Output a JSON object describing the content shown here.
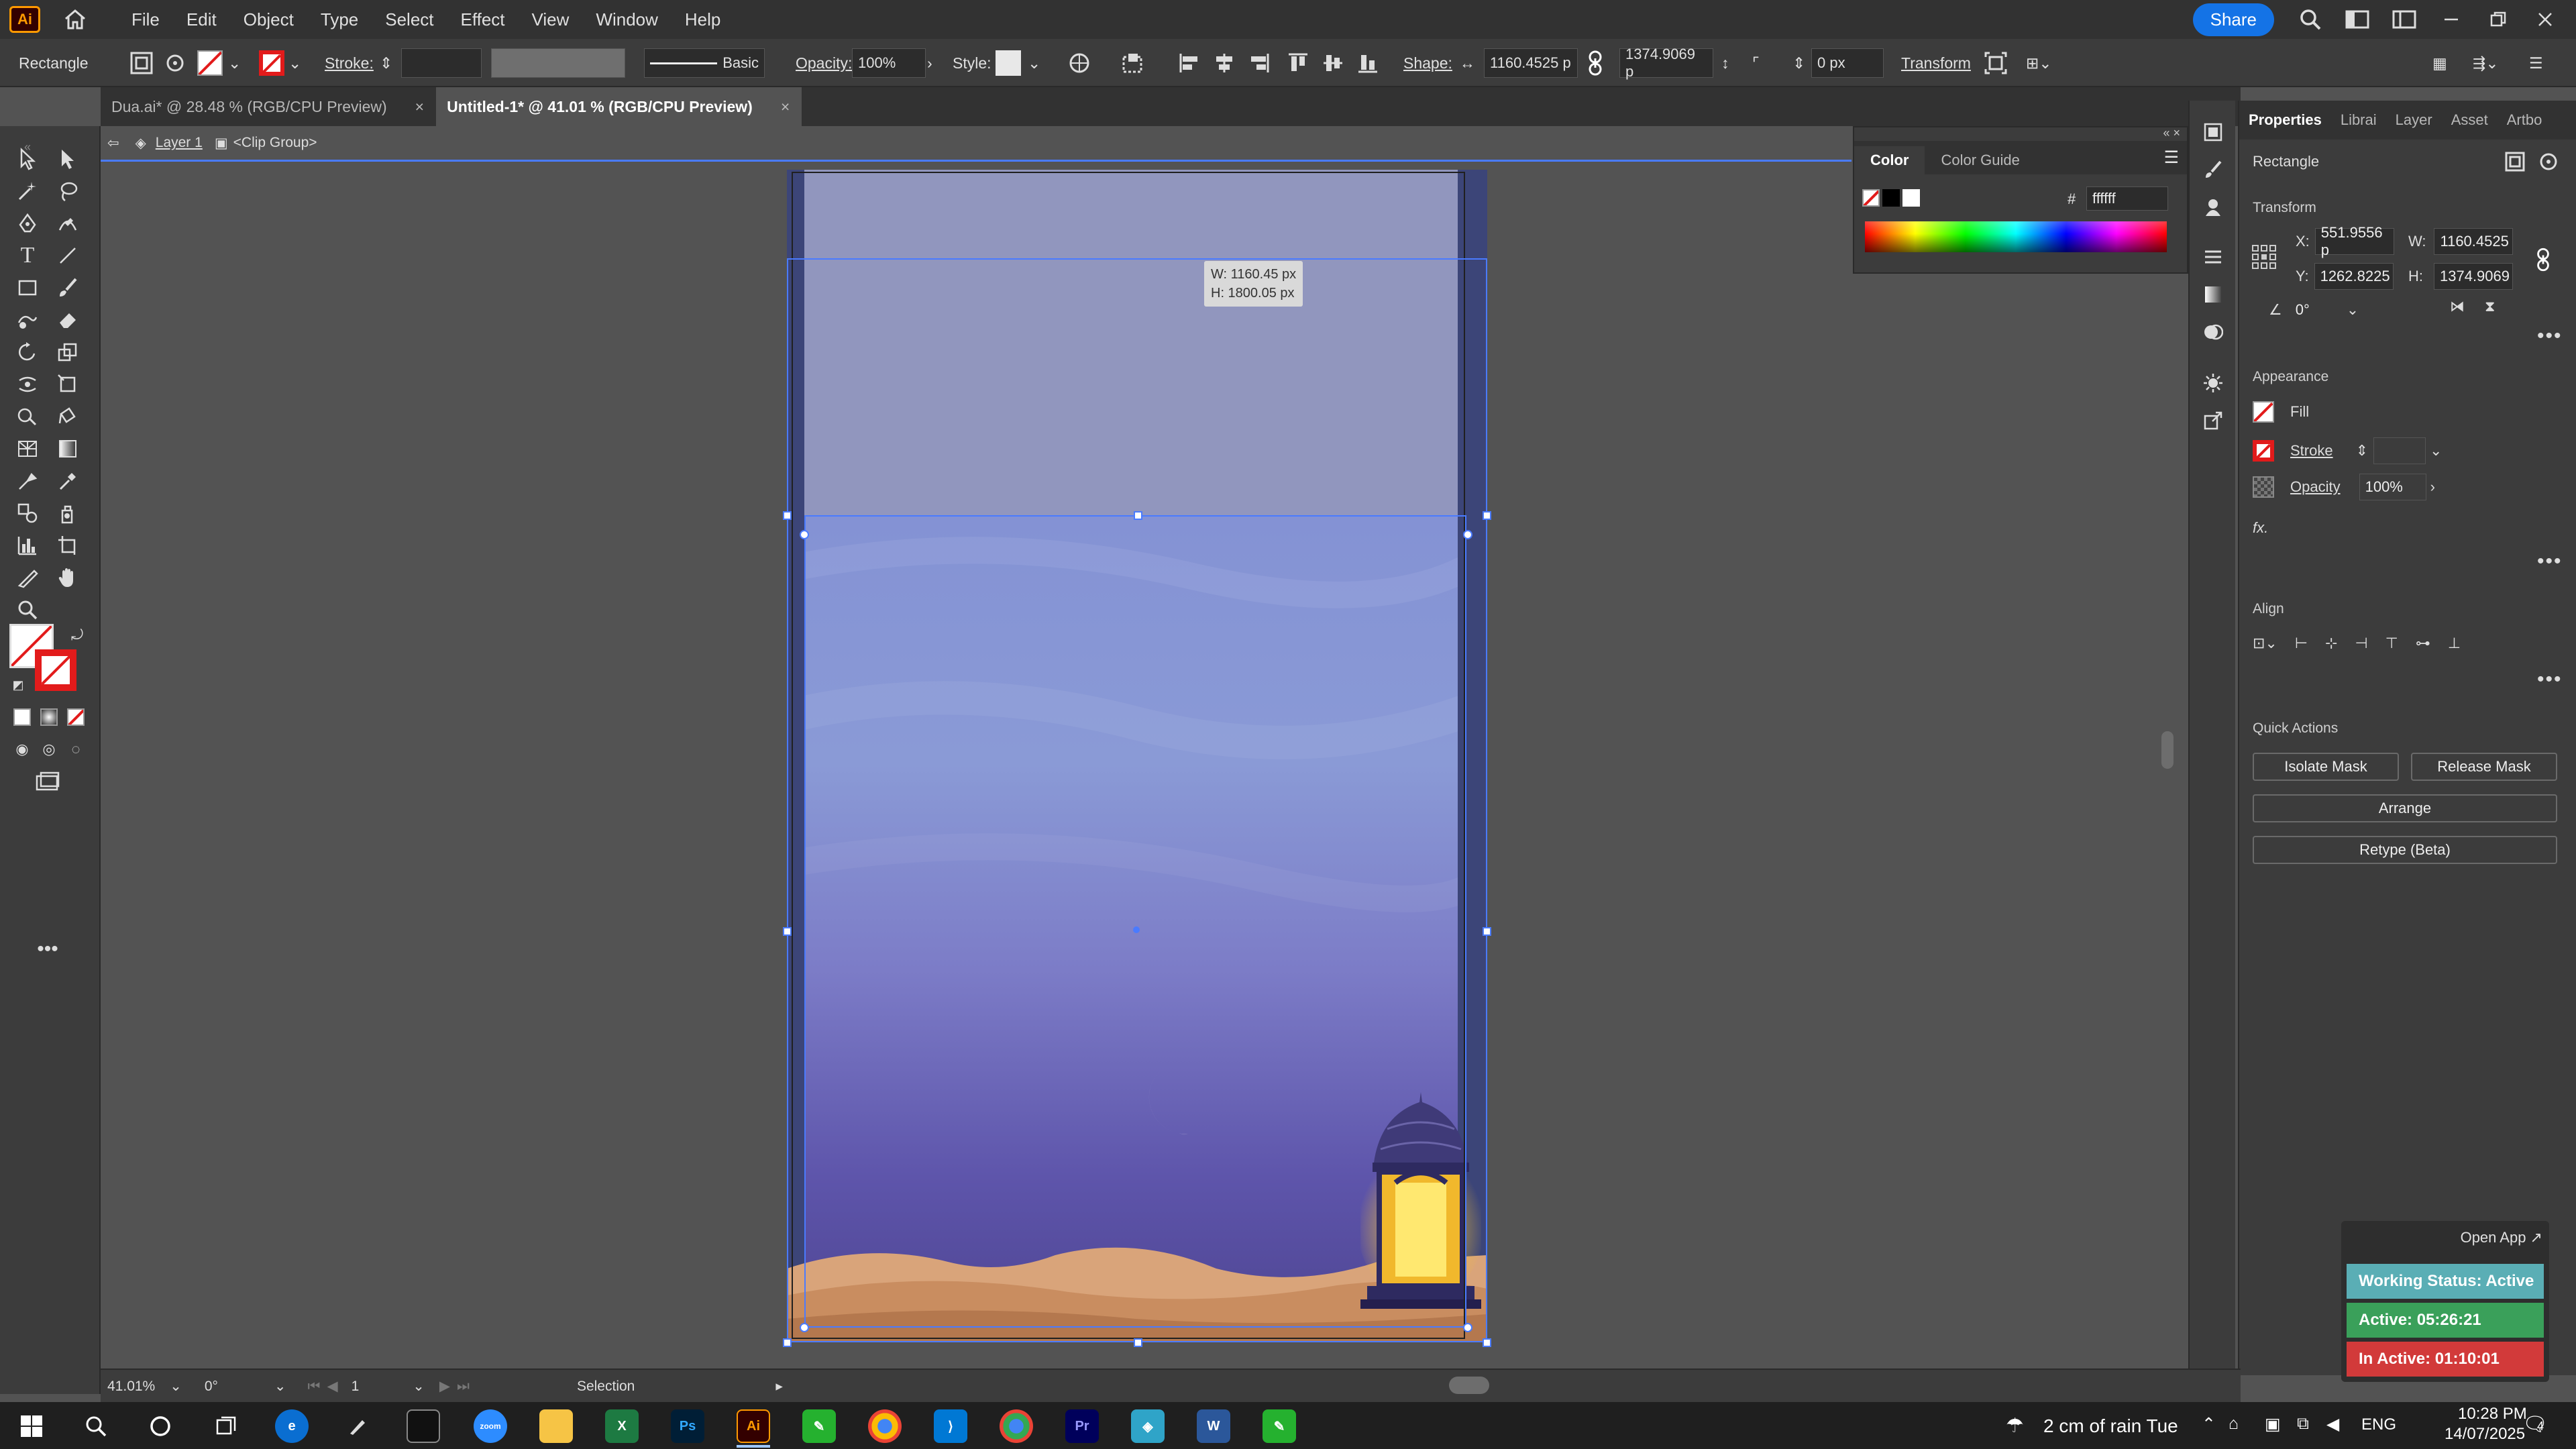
{
  "app": {
    "logo": "Ai",
    "accent": "#ff9a00"
  },
  "menu": {
    "items": [
      "File",
      "Edit",
      "Object",
      "Type",
      "Select",
      "Effect",
      "View",
      "Window",
      "Help"
    ],
    "share_label": "Share"
  },
  "control_bar": {
    "object_type": "Rectangle",
    "stroke_label": "Stroke:",
    "brush_label": "Basic",
    "opacity_label": "Opacity:",
    "opacity_value": "100%",
    "style_label": "Style:",
    "shape_label": "Shape:",
    "width_value": "1160.4525 p",
    "height_value": "1374.9069 p",
    "corner_value": "0 px",
    "transform_label": "Transform"
  },
  "tabs": [
    {
      "label": "Dua.ai* @ 28.48 % (RGB/CPU Preview)",
      "active": false
    },
    {
      "label": "Untitled-1* @ 41.01 % (RGB/CPU Preview)",
      "active": true
    }
  ],
  "breadcrumb": {
    "layer": "Layer 1",
    "group": "<Clip Group>"
  },
  "canvas": {
    "tooltip_w": "W: 1160.45 px",
    "tooltip_h": "H: 1800.05 px"
  },
  "color_panel": {
    "tabs": [
      "Color",
      "Color Guide"
    ],
    "hex_label": "#",
    "hex_value": "ffffff"
  },
  "properties": {
    "tabs": [
      "Properties",
      "Librai",
      "Layer",
      "Asset",
      "Artbo"
    ],
    "object_type": "Rectangle",
    "transform_heading": "Transform",
    "x_label": "X:",
    "x_value": "551.9556 p",
    "y_label": "Y:",
    "y_value": "1262.8225",
    "w_label": "W:",
    "w_value": "1160.4525",
    "h_label": "H:",
    "h_value": "1374.9069",
    "angle_value": "0°",
    "appearance_heading": "Appearance",
    "fill_label": "Fill",
    "stroke_label": "Stroke",
    "opacity_label": "Opacity",
    "opacity_value": "100%",
    "fx_label": "fx.",
    "align_heading": "Align",
    "quick_actions_heading": "Quick Actions",
    "isolate_mask": "Isolate Mask",
    "release_mask": "Release Mask",
    "arrange": "Arrange",
    "retype": "Retype (Beta)"
  },
  "status_bar": {
    "zoom": "41.01%",
    "rotation": "0°",
    "artboard": "1",
    "tool": "Selection"
  },
  "widget": {
    "open_app": "Open App ↗",
    "working_status": "Working Status: Active",
    "active": "Active: 05:26:21",
    "inactive": "In Active: 01:10:01",
    "colors": {
      "status": "#5aaeb5",
      "active": "#3aa05a",
      "inactive": "#d23a3a"
    }
  },
  "taskbar": {
    "weather": "2 cm of rain Tue",
    "language": "ENG",
    "time": "10:28 PM",
    "date": "14/07/2025",
    "notifications": "4"
  }
}
